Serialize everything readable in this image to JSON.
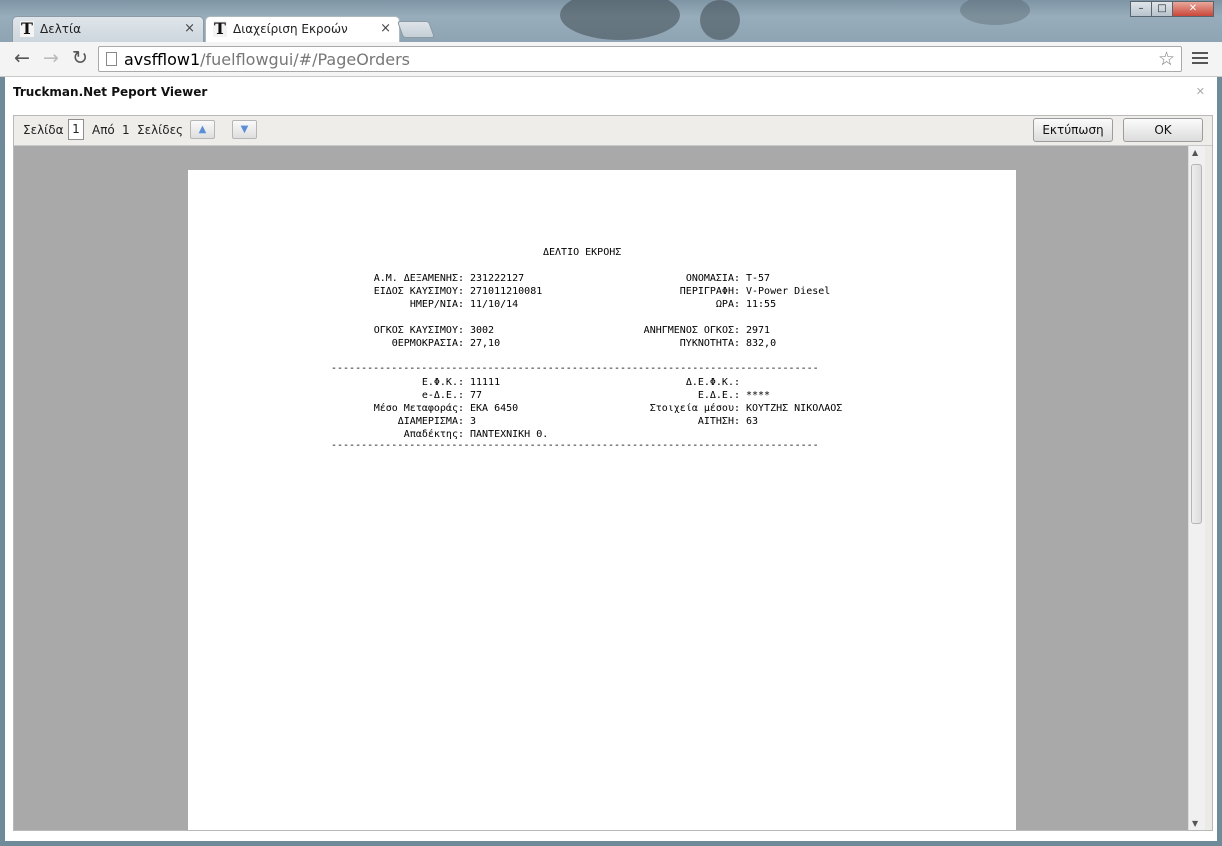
{
  "browser": {
    "tabs": [
      {
        "label": "Δελτία",
        "favicon": "T"
      },
      {
        "label": "Διαχείριση Εκροών",
        "favicon": "T"
      }
    ],
    "tab_close": "×",
    "url_host": "avsfflow1",
    "url_path": "/fuelflowgui/#/PageOrders",
    "icons": [
      "back-arrow-icon",
      "forward-arrow-icon",
      "reload-icon",
      "page-icon",
      "star-icon",
      "menu-icon",
      "minimize-icon",
      "maximize-icon",
      "close-icon"
    ]
  },
  "dialog": {
    "title": "Truckman.Net Peport Viewer"
  },
  "viewer": {
    "page_label": "Σελίδα",
    "page_value": "1",
    "of_label": "Από",
    "total_pages": "1",
    "pages_label": "Σελίδες",
    "print_label": "Εκτύπωση",
    "ok_label": "OK"
  },
  "report": {
    "title": "ΔΕΛΤΙΟ ΕΚΡΟΗΣ",
    "left_block1": [
      {
        "label": "Α.Μ. ΔΕΞΑΜΕΝΗΣ:",
        "value": "231222127"
      },
      {
        "label": "ΕΙΔΟΣ ΚΑΥΣΙΜΟΥ:",
        "value": "271011210081"
      },
      {
        "label": "ΗΜΕΡ/ΝΙΑ:",
        "value": "11/10/14"
      }
    ],
    "right_block1": [
      {
        "label": "ΟΝΟΜΑΣΙΑ:",
        "value": "T-57"
      },
      {
        "label": "ΠΕΡΙΓΡΑΦΗ:",
        "value": "V-Power Diesel"
      },
      {
        "label": "ΩΡΑ:",
        "value": "11:55"
      }
    ],
    "left_block2": [
      {
        "label": "ΟΓΚΟΣ ΚΑΥΣΙΜΟΥ:",
        "value": "3002"
      },
      {
        "label": "ΘΕΡΜΟΚΡΑΣΙΑ:",
        "value": "27,10"
      }
    ],
    "right_block2": [
      {
        "label": "ΑΝΗΓΜΕΝΟΣ ΟΓΚΟΣ:",
        "value": "2971"
      },
      {
        "label": "ΠΥΚΝΟΤΗΤΑ:",
        "value": "832,0"
      }
    ],
    "left_block3": [
      {
        "label": "Ε.Φ.Κ.:",
        "value": "11111"
      },
      {
        "label": "e-Δ.Ε.:",
        "value": "77"
      },
      {
        "label": "Μέσο Μεταφοράς:",
        "value": "ΕΚΑ 6450"
      },
      {
        "label": "ΔΙΑΜΕΡΙΣΜΑ:",
        "value": "3"
      },
      {
        "label": "Απαδέκτης:",
        "value": "ΠΑΝΤΕΧΝΙΚΗ Θ."
      }
    ],
    "right_block3": [
      {
        "label": "Δ.Ε.Φ.Κ.:",
        "value": ""
      },
      {
        "label": "Ε.Δ.Ε.:",
        "value": "****"
      },
      {
        "label": "Στοιχεία μέσου:",
        "value": "ΚΟΥΤΖΗΣ ΝΙΚΟΛΑΟΣ"
      },
      {
        "label": "ΑΙΤΗΣΗ:",
        "value": "63"
      }
    ],
    "separator": "---------------------------------------------------------------------------------"
  }
}
